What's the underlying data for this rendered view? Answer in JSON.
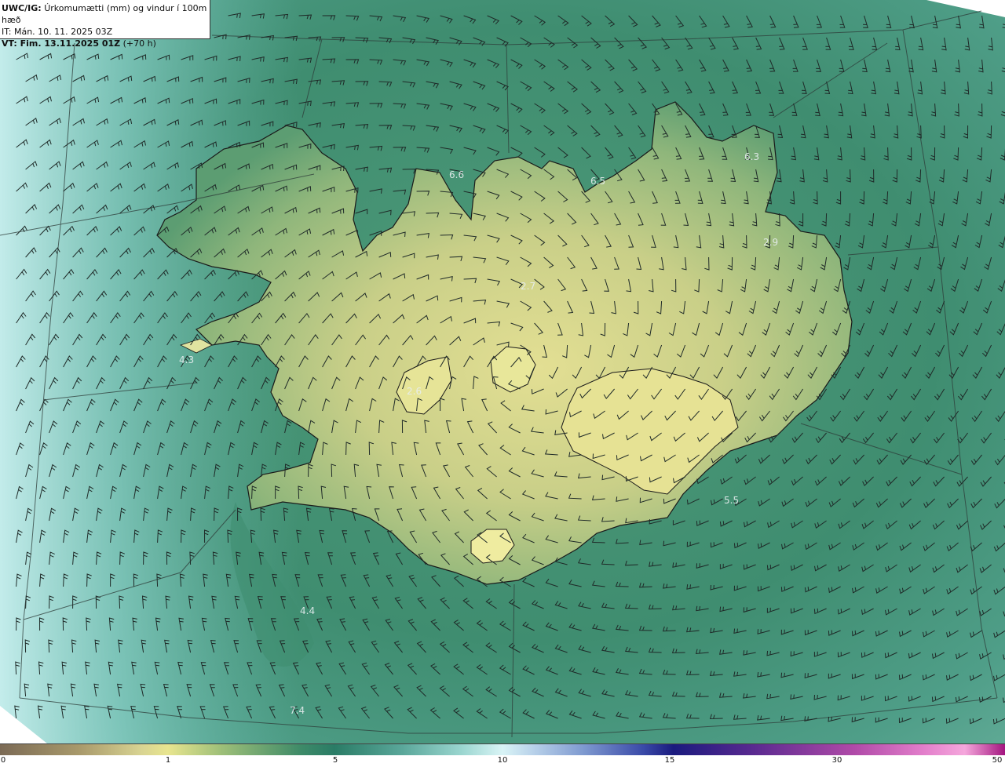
{
  "header": {
    "product_code": "UWC/IG:",
    "product_title": "Úrkomumætti (mm) og vindur í 100m hæð",
    "init_time": "IT: Mán. 10. 11. 2025 03Z",
    "valid_prefix": "VT: Fim. 13.11.2025 01Z",
    "valid_suffix": "(+70 h)"
  },
  "colorbar": {
    "labels": [
      {
        "text": "0",
        "value": 0
      },
      {
        "text": "1",
        "value": 1
      },
      {
        "text": "5",
        "value": 5
      },
      {
        "text": "10",
        "value": 10
      },
      {
        "text": "15",
        "value": 15
      },
      {
        "text": "30",
        "value": 30
      },
      {
        "text": "50",
        "value": 50
      }
    ]
  },
  "map_values": [
    {
      "text": "6.6"
    },
    {
      "text": "6.5"
    },
    {
      "text": "6.3"
    },
    {
      "text": "2.9"
    },
    {
      "text": "2.7"
    },
    {
      "text": "4.3"
    },
    {
      "text": "2.6"
    },
    {
      "text": "5.5"
    },
    {
      "text": "4.4"
    },
    {
      "text": "7.4"
    }
  ],
  "colors": {
    "ocean_teal": "#3d8a6e",
    "land_yellow": "#d8d48a",
    "coast_line": "#1a1a1a",
    "barb": "#1f2a28"
  }
}
